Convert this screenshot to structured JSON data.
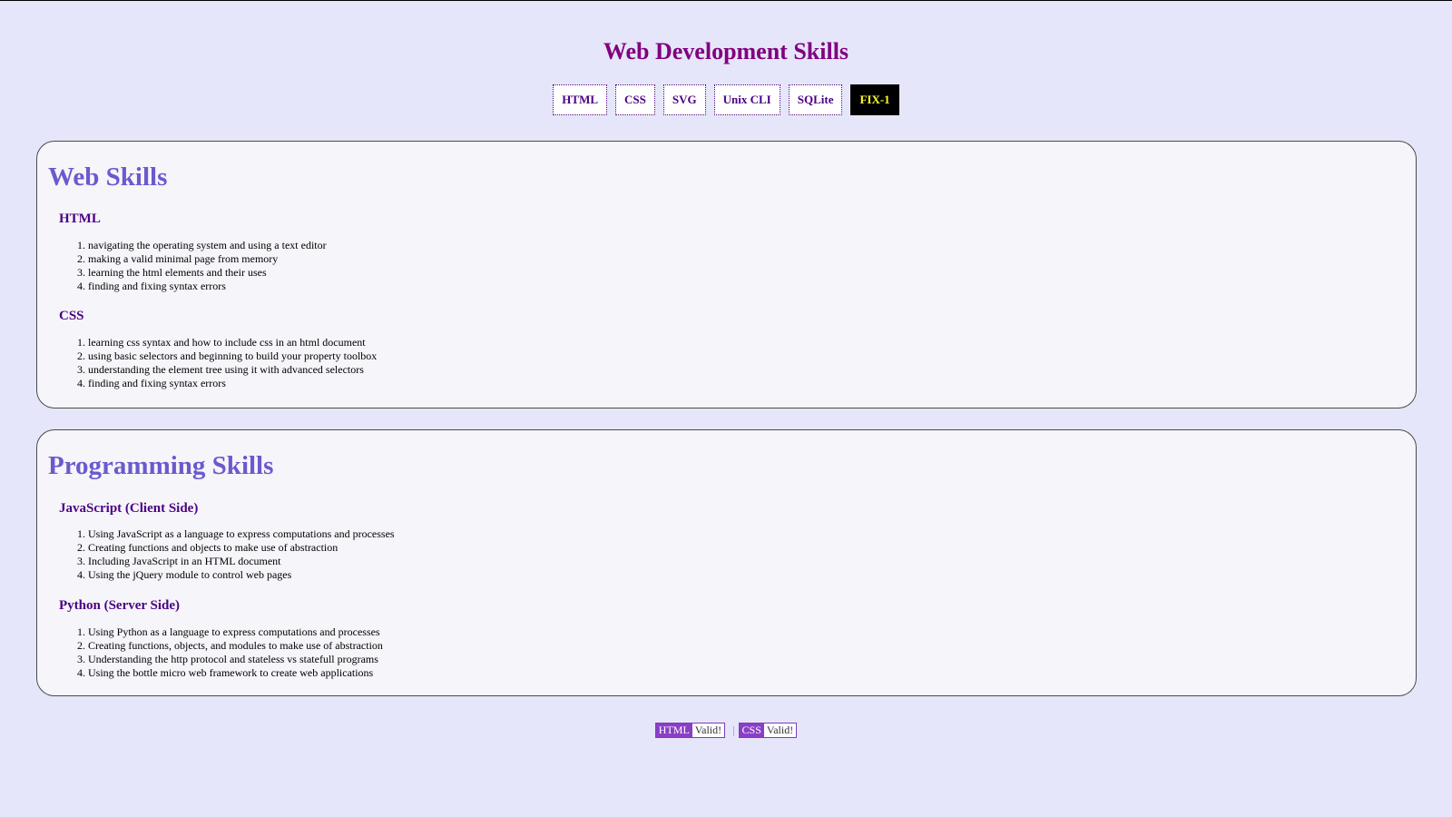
{
  "page": {
    "title": "Web Development Skills"
  },
  "nav": {
    "items": [
      {
        "label": "HTML"
      },
      {
        "label": "CSS"
      },
      {
        "label": "SVG"
      },
      {
        "label": "Unix CLI"
      },
      {
        "label": "SQLite"
      },
      {
        "label": "FIX-1",
        "active": true
      }
    ]
  },
  "sections": [
    {
      "title": "Web Skills",
      "groups": [
        {
          "title": "HTML",
          "items": [
            "navigating the operating system and using a text editor",
            "making a valid minimal page from memory",
            "learning the html elements and their uses",
            "finding and fixing syntax errors"
          ]
        },
        {
          "title": "CSS",
          "items": [
            "learning css syntax and how to include css in an html document",
            "using basic selectors and beginning to build your property toolbox",
            "understanding the element tree using it with advanced selectors",
            "finding and fixing syntax errors"
          ]
        }
      ]
    },
    {
      "title": "Programming Skills",
      "groups": [
        {
          "title": "JavaScript (Client Side)",
          "items": [
            "Using JavaScript as a language to express computations and processes",
            "Creating functions and objects to make use of abstraction",
            "Including JavaScript in an HTML document",
            "Using the jQuery module to control web pages"
          ]
        },
        {
          "title": "Python (Server Side)",
          "items": [
            "Using Python as a language to express computations and processes",
            "Creating functions, objects, and modules to make use of abstraction",
            "Understanding the http protocol and stateless vs statefull programs",
            "Using the bottle micro web framework to create web applications"
          ]
        }
      ]
    }
  ],
  "footer": {
    "html_badge": {
      "tag": "HTML",
      "status": "Valid!"
    },
    "separator": "|",
    "css_badge": {
      "tag": "CSS",
      "status": "Valid!"
    }
  },
  "colors": {
    "background": "#e6e6fa",
    "panel": "#f5f5fa",
    "title": "#800080",
    "section_title": "#6a5acd",
    "subheading": "#4b0082",
    "active_nav_text": "#ffff33",
    "badge": "#8a3fc6"
  }
}
